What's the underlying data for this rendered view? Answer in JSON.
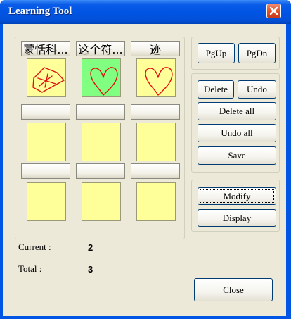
{
  "window": {
    "title": "Learning Tool"
  },
  "characters": [
    {
      "label": "蒙恬科...",
      "color": "#ffff99",
      "has_drawing": true,
      "drawing": "star-scribble"
    },
    {
      "label": "这个符...",
      "color": "#80ff80",
      "has_drawing": true,
      "drawing": "heart"
    },
    {
      "label": "迹",
      "color": "#ffff99",
      "has_drawing": true,
      "drawing": "heart"
    },
    {
      "label": "",
      "color": "#ffff99",
      "has_drawing": false
    },
    {
      "label": "",
      "color": "#ffff99",
      "has_drawing": false
    },
    {
      "label": "",
      "color": "#ffff99",
      "has_drawing": false
    },
    {
      "label": "",
      "color": "#ffff99",
      "has_drawing": false
    },
    {
      "label": "",
      "color": "#ffff99",
      "has_drawing": false
    },
    {
      "label": "",
      "color": "#ffff99",
      "has_drawing": false
    }
  ],
  "nav": {
    "pgup": "PgUp",
    "pgdn": "PgDn"
  },
  "edit": {
    "delete": "Delete",
    "undo": "Undo",
    "delete_all": "Delete all",
    "undo_all": "Undo all",
    "save": "Save"
  },
  "mode": {
    "modify": "Modify",
    "display": "Display"
  },
  "status": {
    "current_label": "Current :",
    "current_value": "2",
    "total_label": "Total :",
    "total_value": "3"
  },
  "footer": {
    "close": "Close"
  },
  "colors": {
    "titlebar": "#0054e3",
    "client": "#ece9d8",
    "tile_yellow": "#ffff99",
    "tile_selected": "#80ff80",
    "stroke": "#e01010"
  }
}
